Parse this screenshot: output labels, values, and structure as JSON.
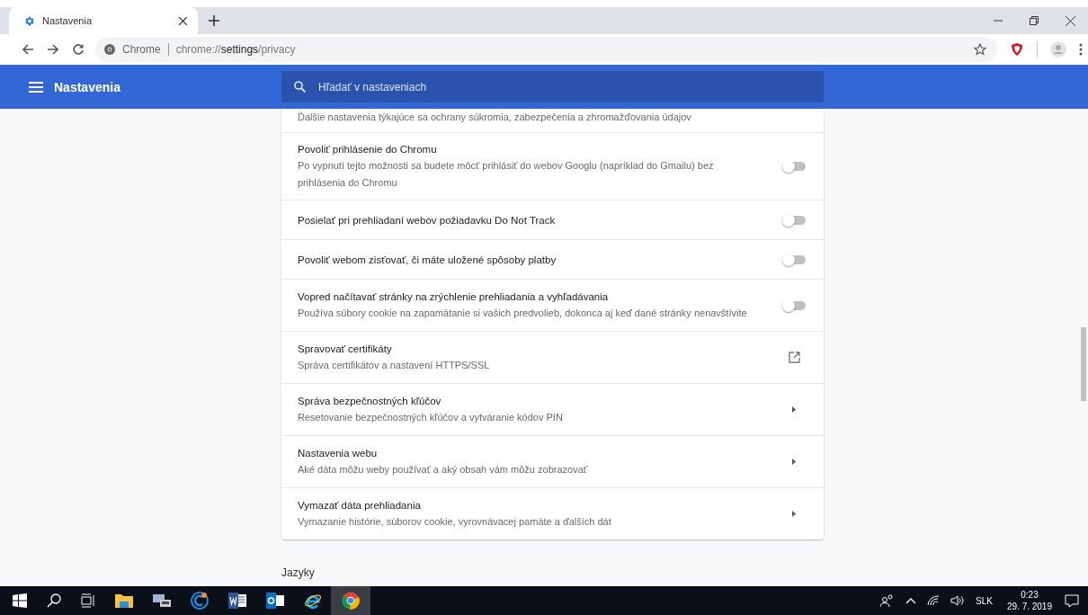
{
  "browser": {
    "tabs": [
      {
        "title": "Nastavenia",
        "selected": true
      }
    ],
    "address": {
      "site_label": "Chrome",
      "url_prefix": "chrome://",
      "url_host": "settings",
      "url_path": "/privacy"
    }
  },
  "header": {
    "title": "Nastavenia",
    "search": {
      "placeholder": "Hľadať v nastaveniach"
    }
  },
  "settings": [
    {
      "kind": "partial",
      "description": "Ďalšie nastavenia týkajúce sa ochrany súkromia, zabezpečenia a zhromažďovania údajov"
    },
    {
      "kind": "toggle",
      "label": "Povoliť prihlásenie do Chromu",
      "description": "Po vypnutí tejto možnosti sa budete môcť prihlásiť do webov Googlu (napríklad do Gmailu) bez prihlásenia do Chromu",
      "on": false
    },
    {
      "kind": "toggle",
      "label": "Posielať pri prehliadaní webov požiadavku Do Not Track",
      "on": false
    },
    {
      "kind": "toggle",
      "label": "Povoliť webom zisťovať, či máte uložené spôsoby platby",
      "on": false
    },
    {
      "kind": "toggle",
      "label": "Vopred načítavať stránky na zrýchlenie prehliadania a vyhľadávania",
      "description": "Používa súbory cookie na zapamätanie si vašich predvolieb, dokonca aj keď dané stránky nenavštívite",
      "on": false
    },
    {
      "kind": "external",
      "label": "Spravovať certifikáty",
      "description": "Správa certifikátov a nastavení HTTPS/SSL"
    },
    {
      "kind": "arrow",
      "label": "Správa bezpečnostných kľúčov",
      "description": "Resetovanie bezpečnostných kľúčov a vytváranie kódov PIN"
    },
    {
      "kind": "arrow",
      "label": "Nastavenia webu",
      "description": "Aké dáta môžu weby používať a aký obsah vám môžu zobrazovať"
    },
    {
      "kind": "arrow",
      "label": "Vymazať dáta prehliadania",
      "description": "Vymazanie histórie, súborov cookie, vyrovnávacej pamäte a ďalších dát"
    }
  ],
  "next_section": "Jazyky",
  "taskbar": {
    "language": "SLK",
    "time": "0:23",
    "date": "29. 7. 2019"
  }
}
